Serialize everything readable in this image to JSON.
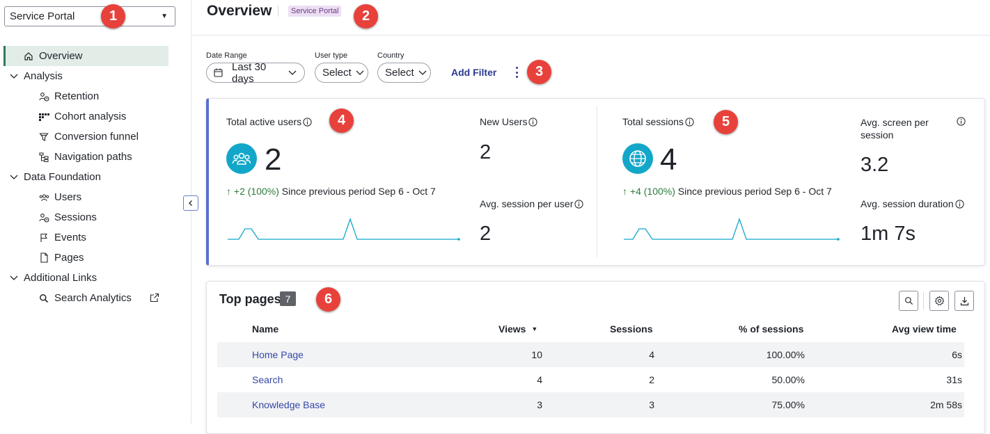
{
  "sidebar": {
    "portal_selector": {
      "value": "Service Portal"
    },
    "items": [
      {
        "label": "Overview",
        "icon": "home-icon",
        "active": true
      },
      {
        "label": "Analysis",
        "icon": "chevron-down-icon",
        "group": true
      },
      {
        "label": "Retention",
        "icon": "retention-icon"
      },
      {
        "label": "Cohort analysis",
        "icon": "cohort-icon"
      },
      {
        "label": "Conversion funnel",
        "icon": "funnel-icon"
      },
      {
        "label": "Navigation paths",
        "icon": "tree-icon"
      },
      {
        "label": "Data Foundation",
        "icon": "chevron-down-icon",
        "group": true
      },
      {
        "label": "Users",
        "icon": "users-icon"
      },
      {
        "label": "Sessions",
        "icon": "sessions-icon"
      },
      {
        "label": "Events",
        "icon": "flag-icon"
      },
      {
        "label": "Pages",
        "icon": "page-icon"
      },
      {
        "label": "Additional Links",
        "icon": "chevron-down-icon",
        "group": true
      },
      {
        "label": "Search Analytics",
        "icon": "search-icon",
        "external": true
      }
    ]
  },
  "header": {
    "title": "Overview",
    "badge": "Service Portal"
  },
  "markers": [
    "1",
    "2",
    "3",
    "4",
    "5",
    "6"
  ],
  "filters": {
    "date_range": {
      "label": "Date Range",
      "value": "Last 30 days"
    },
    "user_type": {
      "label": "User type",
      "value": "Select"
    },
    "country": {
      "label": "Country",
      "value": "Select"
    },
    "add_filter": "Add Filter"
  },
  "metrics": {
    "users": {
      "label": "Total active users",
      "value": "2",
      "change_value": "+2 (100%)",
      "change_text": "Since previous period Sep 6 - Oct 7",
      "new_users_label": "New Users",
      "new_users_value": "2",
      "avg_session_label": "Avg. session per user",
      "avg_session_value": "2"
    },
    "sessions": {
      "label": "Total sessions",
      "value": "4",
      "change_value": "+4 (100%)",
      "change_text": "Since previous period Sep 6 - Oct 7",
      "avg_screen_label": "Avg. screen per session",
      "avg_screen_value": "3.2",
      "avg_duration_label": "Avg. session duration",
      "avg_duration_value": "1m 7s"
    },
    "accent_color": "#12a7c9"
  },
  "top_pages": {
    "title": "Top pages",
    "count": "7",
    "columns": [
      "Name",
      "Views",
      "Sessions",
      "% of sessions",
      "Avg view time"
    ],
    "rows": [
      {
        "name": "Home Page",
        "views": "10",
        "sessions": "4",
        "pct": "100.00%",
        "avg": "6s"
      },
      {
        "name": "Search",
        "views": "4",
        "sessions": "2",
        "pct": "50.00%",
        "avg": "31s"
      },
      {
        "name": "Knowledge Base",
        "views": "3",
        "sessions": "3",
        "pct": "75.00%",
        "avg": "2m 58s"
      }
    ]
  }
}
